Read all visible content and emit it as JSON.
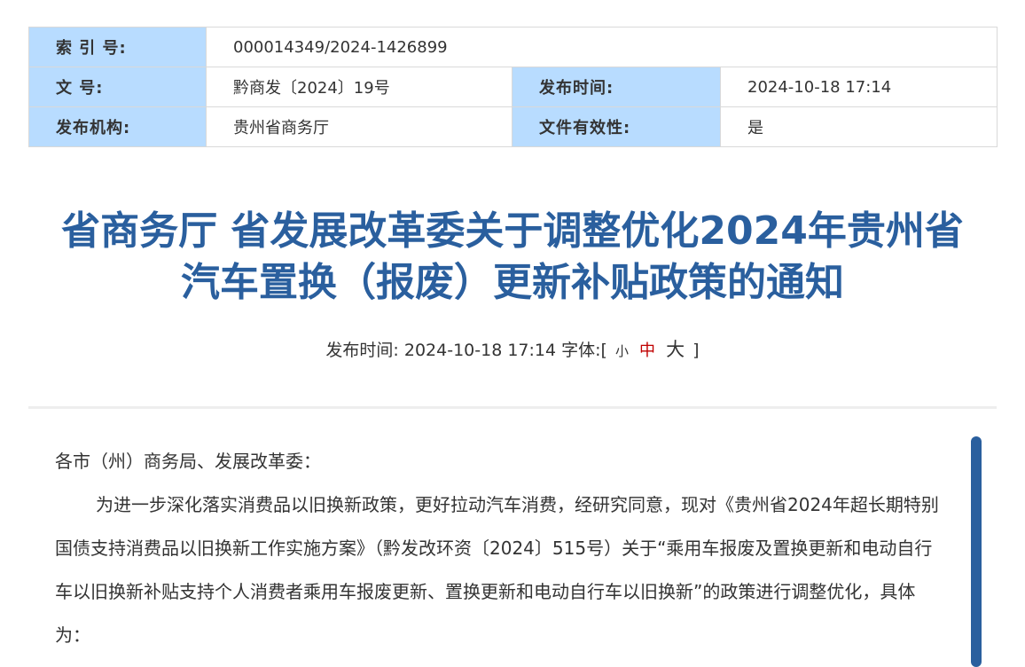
{
  "meta": {
    "index_label": "索 引 号:",
    "index_value": "000014349/2024-1426899",
    "docno_label": "文 号:",
    "docno_value": "黔商发〔2024〕19号",
    "pubtime_label": "发布时间:",
    "pubtime_value": "2024-10-18 17:14",
    "issuer_label": "发布机构:",
    "issuer_value": "贵州省商务厅",
    "validity_label": "文件有效性:",
    "validity_value": "是"
  },
  "article": {
    "title_line1": "省商务厅 省发展改革委关于调整优化2024年贵州省",
    "title_line2": "汽车置换（报废）更新补贴政策的通知",
    "pub_prefix": "发布时间: 2024-10-18 17:14 字体:[",
    "font_small": "小",
    "font_medium": "中",
    "font_large": "大",
    "pub_suffix": "]",
    "salutation": "各市（州）商务局、发展改革委：",
    "paragraph1": "为进一步深化落实消费品以旧换新政策，更好拉动汽车消费，经研究同意，现对《贵州省2024年超长期特别国债支持消费品以旧换新工作实施方案》（黔发改环资〔2024〕515号）关于“乘用车报废及置换更新和电动自行车以旧换新补贴支持个人消费者乘用车报废更新、置换更新和电动自行车以旧换新”的政策进行调整优化，具体为："
  },
  "colors": {
    "title_blue": "#2a5f9e",
    "label_bg": "#b8dcff",
    "font_medium_red": "#c00000"
  }
}
